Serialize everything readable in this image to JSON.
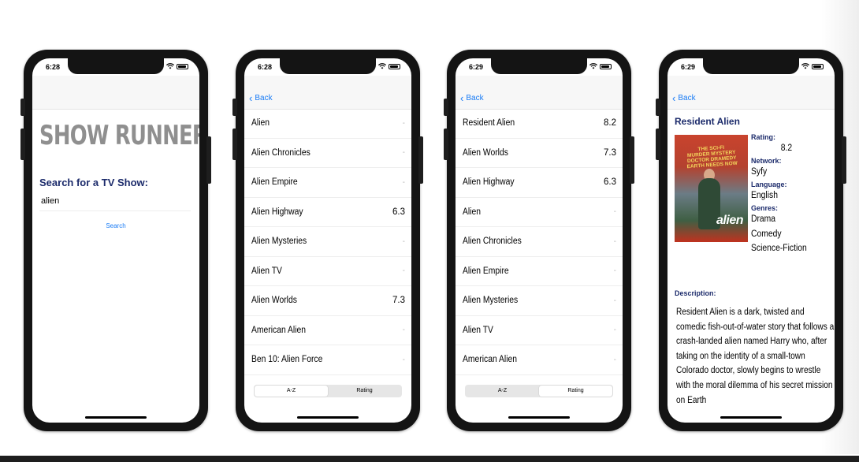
{
  "screen1": {
    "time": "6:28",
    "logo": "SHOW RUNNER",
    "search_label": "Search for a TV Show:",
    "search_value": "alien",
    "search_button": "Search"
  },
  "screen2": {
    "time": "6:28",
    "back": "Back",
    "rows": [
      {
        "name": "Alien",
        "rating": "-"
      },
      {
        "name": "Alien Chronicles",
        "rating": "-"
      },
      {
        "name": "Alien Empire",
        "rating": "-"
      },
      {
        "name": "Alien Highway",
        "rating": "6.3"
      },
      {
        "name": "Alien Mysteries",
        "rating": "-"
      },
      {
        "name": "Alien TV",
        "rating": "-"
      },
      {
        "name": "Alien Worlds",
        "rating": "7.3"
      },
      {
        "name": "American Alien",
        "rating": "-"
      },
      {
        "name": "Ben 10: Alien Force",
        "rating": "-"
      }
    ],
    "segments": [
      "A-Z",
      "Rating"
    ],
    "selected_segment": "A-Z"
  },
  "screen3": {
    "time": "6:29",
    "back": "Back",
    "rows": [
      {
        "name": "Resident Alien",
        "rating": "8.2"
      },
      {
        "name": "Alien Worlds",
        "rating": "7.3"
      },
      {
        "name": "Alien Highway",
        "rating": "6.3"
      },
      {
        "name": "Alien",
        "rating": "-"
      },
      {
        "name": "Alien Chronicles",
        "rating": "-"
      },
      {
        "name": "Alien Empire",
        "rating": "-"
      },
      {
        "name": "Alien Mysteries",
        "rating": "-"
      },
      {
        "name": "Alien TV",
        "rating": "-"
      },
      {
        "name": "American Alien",
        "rating": "-"
      }
    ],
    "segments": [
      "A-Z",
      "Rating"
    ],
    "selected_segment": "Rating"
  },
  "screen4": {
    "time": "6:29",
    "back": "Back",
    "title": "Resident Alien",
    "poster": {
      "tagline": "THE SCI-FI MURDER MYSTERY DOCTOR DRAMEDY EARTH NEEDS NOW",
      "brand": "alien"
    },
    "rating_label": "Rating:",
    "rating_value": "8.2",
    "network_label": "Network:",
    "network_value": "Syfy",
    "language_label": "Language:",
    "language_value": "English",
    "genres_label": "Genres:",
    "genres": [
      "Drama",
      "Comedy",
      "Science-Fiction"
    ],
    "description_label": "Description:",
    "description": "Resident Alien is a dark, twisted and comedic fish-out-of-water story that follows a crash-landed alien named Harry who, after taking on the identity of a small-town Colorado doctor, slowly begins to wrestle with the moral dilemma of his secret mission on Earth"
  },
  "colors": {
    "accent_blue": "#1a7cf5",
    "heading_navy": "#1c2b6b"
  }
}
